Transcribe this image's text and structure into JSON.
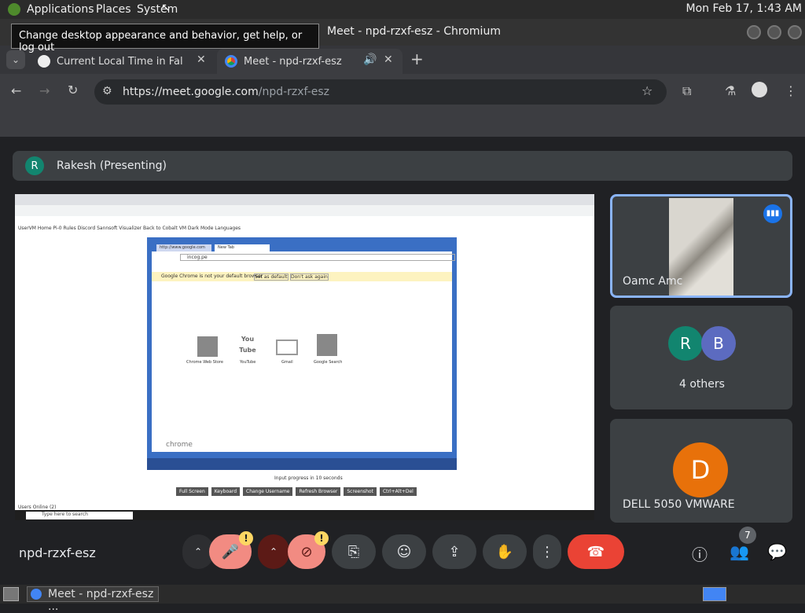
{
  "panel": {
    "applications": "Applications",
    "places": "Places",
    "system": "System",
    "clock": "Mon Feb 17,  1:43 AM",
    "tooltip": "Change desktop appearance and behavior, get help, or log out"
  },
  "window": {
    "title": "Meet - npd-rzxf-esz - Chromium"
  },
  "tabs": [
    {
      "label": "Current Local Time in Fall Riv"
    },
    {
      "label": "Meet - npd-rzxf-esz"
    }
  ],
  "address": {
    "host": "https://meet.google.com",
    "path": "/npd-rzxf-esz"
  },
  "meet": {
    "presenter_initial": "R",
    "presenting_label": "Rakesh (Presenting)",
    "participants": [
      {
        "name": "Oamc Amc"
      },
      {
        "initials": [
          "R",
          "B"
        ],
        "label": "4 others"
      },
      {
        "initial": "D",
        "name": "DELL 5050 VMWARE"
      }
    ],
    "meeting_code": "npd-rzxf-esz",
    "people_count": "7",
    "warn_mark": "!"
  },
  "shared_screen": {
    "bookmarks": "UserVM   Home   Pi-0   Rules   Discord   Sannsoft   Visualizer   Back to Cobalt VM   Dark Mode   Languages",
    "inner_tabs": [
      "http://www.google.com",
      "New Tab"
    ],
    "inner_url": "incog.pe",
    "infobar": "Google Chrome is not your default browser",
    "infobar_btn1": "Set as default",
    "infobar_btn2": "Don't ask again",
    "apps": [
      "Chrome Web Store",
      "YouTube",
      "Gmail",
      "Google Search"
    ],
    "youtube_logo": "You Tube",
    "chrome_label": "chrome",
    "caption": "Input progress in 10 seconds",
    "buttons": [
      "Full Screen",
      "Keyboard",
      "Change Username",
      "Refresh Browser",
      "Screenshot",
      "Ctrl+Alt+Del"
    ],
    "users_online": "Users Online (2)",
    "search_placeholder": "Type here to search"
  },
  "taskbar": {
    "window_label": "Meet - npd-rzxf-esz ..."
  },
  "colors": {
    "accent": "#8ab4f8",
    "end_call": "#ea4335",
    "warn": "#fdd663",
    "presenter": "#12856f",
    "b_avatar": "#5c6bc0",
    "d_avatar": "#e8710a"
  }
}
